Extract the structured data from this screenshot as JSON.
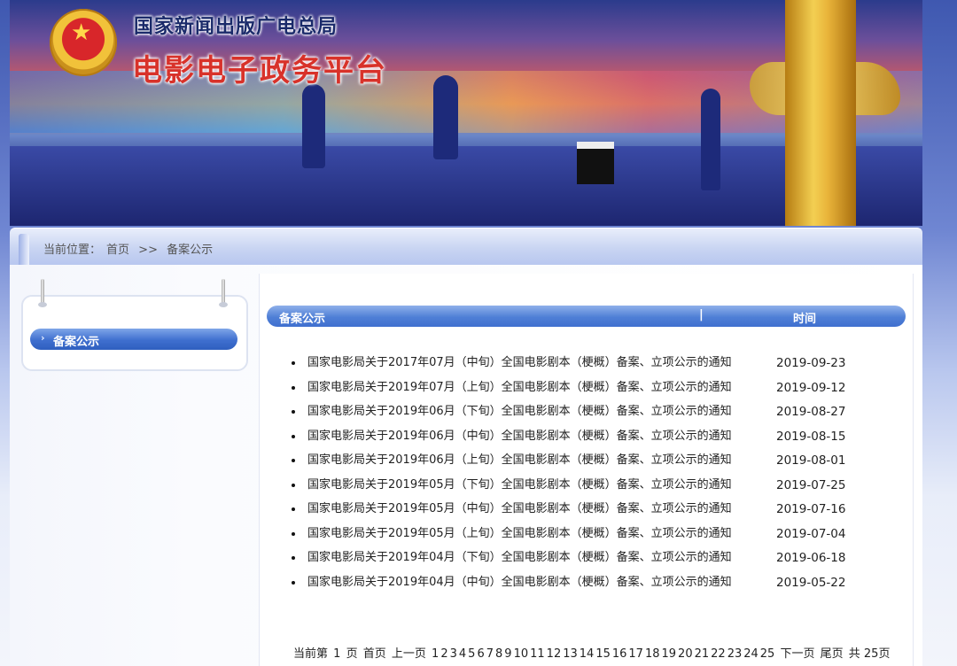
{
  "banner": {
    "bureau_name": "国家新闻出版广电总局",
    "platform_name": "电影电子政务平台"
  },
  "breadcrumb": {
    "label": "当前位置：",
    "home": "首页",
    "separator": ">>",
    "current": "备案公示"
  },
  "sidebar": {
    "items": [
      {
        "label": "备案公示",
        "icon": "chevron-right-icon"
      }
    ]
  },
  "list": {
    "header_title": "备案公示",
    "header_separator": "|",
    "header_time": "时间",
    "notices": [
      {
        "title": "国家电影局关于2017年07月（中旬）全国电影剧本（梗概）备案、立项公示的通知",
        "date": "2019-09-23"
      },
      {
        "title": "国家电影局关于2019年07月（上旬）全国电影剧本（梗概）备案、立项公示的通知",
        "date": "2019-09-12"
      },
      {
        "title": "国家电影局关于2019年06月（下旬）全国电影剧本（梗概）备案、立项公示的通知",
        "date": "2019-08-27"
      },
      {
        "title": "国家电影局关于2019年06月（中旬）全国电影剧本（梗概）备案、立项公示的通知",
        "date": "2019-08-15"
      },
      {
        "title": "国家电影局关于2019年06月（上旬）全国电影剧本（梗概）备案、立项公示的通知",
        "date": "2019-08-01"
      },
      {
        "title": "国家电影局关于2019年05月（下旬）全国电影剧本（梗概）备案、立项公示的通知",
        "date": "2019-07-25"
      },
      {
        "title": "国家电影局关于2019年05月（中旬）全国电影剧本（梗概）备案、立项公示的通知",
        "date": "2019-07-16"
      },
      {
        "title": "国家电影局关于2019年05月（上旬）全国电影剧本（梗概）备案、立项公示的通知",
        "date": "2019-07-04"
      },
      {
        "title": "国家电影局关于2019年04月（下旬）全国电影剧本（梗概）备案、立项公示的通知",
        "date": "2019-06-18"
      },
      {
        "title": "国家电影局关于2019年04月（中旬）全国电影剧本（梗概）备案、立项公示的通知",
        "date": "2019-05-22"
      }
    ]
  },
  "pagination": {
    "current_prefix": "当前第",
    "current_page": "1",
    "current_suffix": "页",
    "first": "首页",
    "prev": "上一页",
    "pages": [
      "1",
      "2",
      "3",
      "4",
      "5",
      "6",
      "7",
      "8",
      "9",
      "10",
      "11",
      "12",
      "13",
      "14",
      "15",
      "16",
      "17",
      "18",
      "19",
      "20",
      "21",
      "22",
      "23",
      "24",
      "25"
    ],
    "next": "下一页",
    "last": "尾页",
    "total": "共 25页"
  },
  "colors": {
    "accent_blue": "#3f6fcf",
    "title_red": "#d8322a",
    "title_navy": "#1a2a6a"
  }
}
